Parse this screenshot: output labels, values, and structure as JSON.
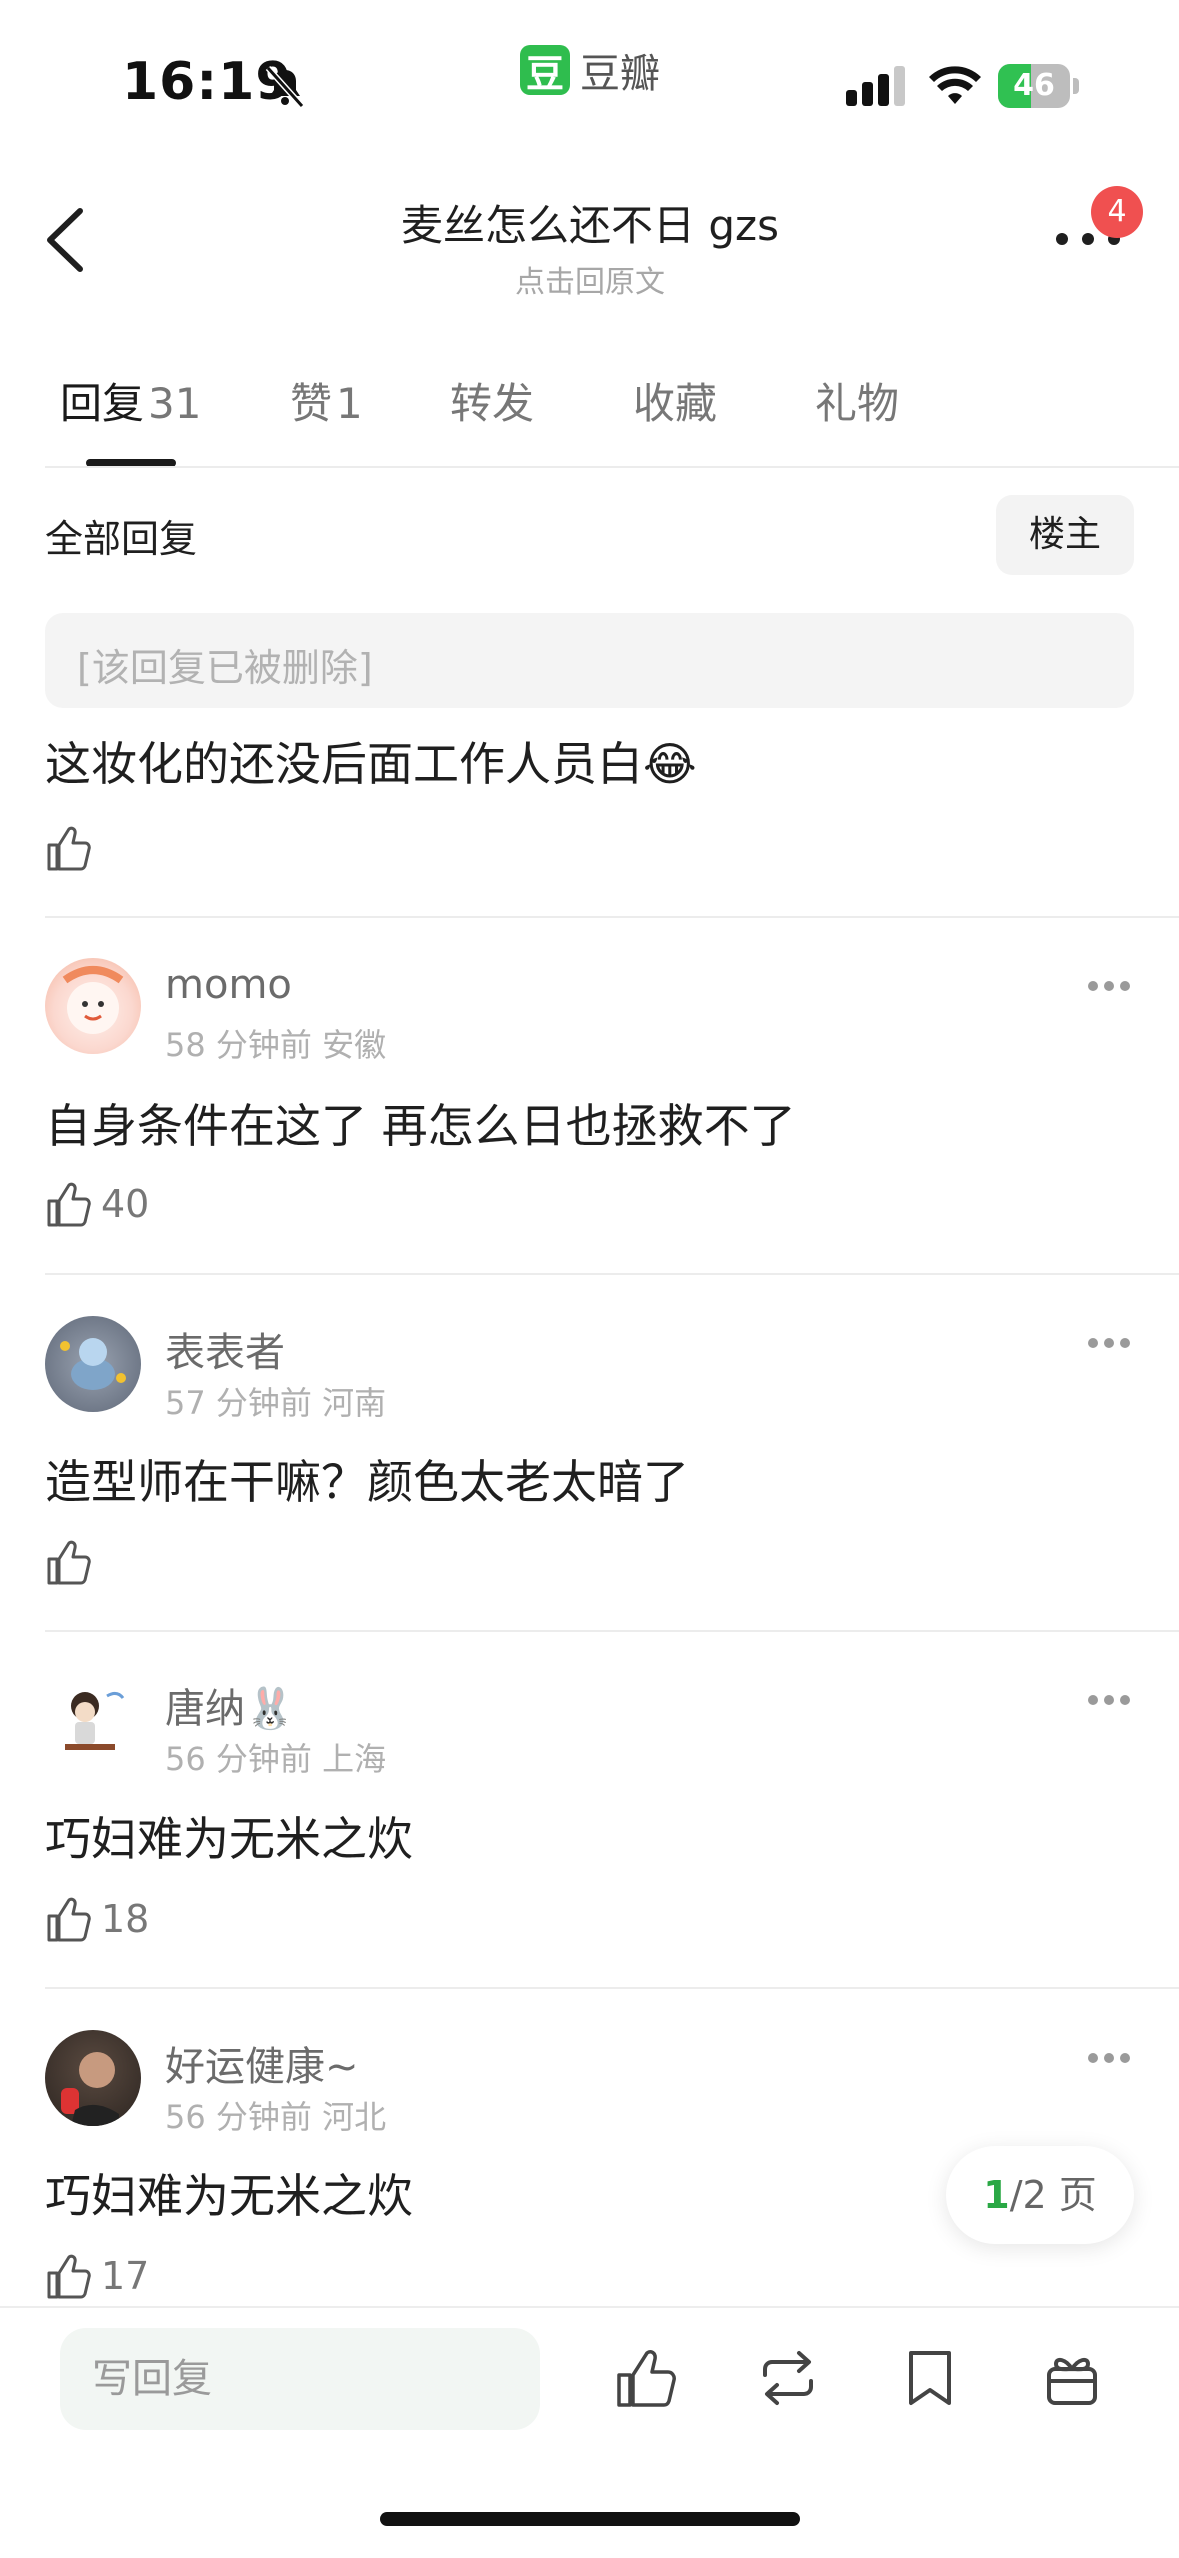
{
  "status_bar": {
    "time": "16:19",
    "app_name": "豆瓣",
    "app_logo_char": "豆",
    "battery_text": "46",
    "battery_level_percent": 46
  },
  "header": {
    "title": "麦丝怎么还不日 gzs",
    "subtitle": "点击回原文",
    "notification_count": "4"
  },
  "tabs": [
    {
      "label": "回复",
      "count": "31",
      "active": true
    },
    {
      "label": "赞",
      "count": "1"
    },
    {
      "label": "转发",
      "count": ""
    },
    {
      "label": "收藏",
      "count": ""
    },
    {
      "label": "礼物",
      "count": ""
    }
  ],
  "section": {
    "title": "全部回复",
    "filter_label": "楼主"
  },
  "first_comment": {
    "quoted_deleted": "[该回复已被删除]",
    "text": "这妆化的还没后面工作人员白😂",
    "likes": ""
  },
  "comments": [
    {
      "user": "momo",
      "meta": "58 分钟前 安徽",
      "text": "自身条件在这了 再怎么日也拯救不了",
      "likes": "40"
    },
    {
      "user": "表表者",
      "meta": "57 分钟前 河南",
      "text": "造型师在干嘛？颜色太老太暗了",
      "likes": ""
    },
    {
      "user": "唐纳🐰",
      "meta": "56 分钟前 上海",
      "text": "巧妇难为无米之炊",
      "likes": "18"
    },
    {
      "user": "好运健康~",
      "meta": "56 分钟前 河北",
      "text": "巧妇难为无米之炊",
      "likes": "17"
    }
  ],
  "pager": {
    "current": "1",
    "rest": "/2 页"
  },
  "bottom_bar": {
    "reply_placeholder": "写回复"
  },
  "colors": {
    "accent_green": "#2aa845",
    "badge_red": "#f05050"
  },
  "icons": [
    "back-icon",
    "more-icon",
    "like-icon",
    "repost-icon",
    "bookmark-icon",
    "gift-icon",
    "bell-slash-icon",
    "signal-icon",
    "wifi-icon",
    "battery-icon"
  ]
}
